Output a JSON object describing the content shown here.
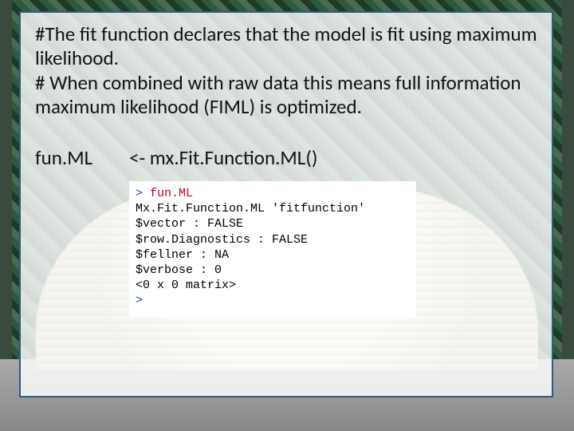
{
  "comment": {
    "line1": "#The fit function declares that the model is fit using maximum likelihood.",
    "line2": "# When combined with raw data this means full information maximum likelihood (FIML) is optimized."
  },
  "code": {
    "lhs": "fun.ML",
    "rhs": "<- mx.Fit.Function.ML()"
  },
  "console": {
    "prompt": ">",
    "input": "fun.ML",
    "lines": [
      "Mx.Fit.Function.ML 'fitfunction'",
      "$vector : FALSE",
      "$row.Diagnostics : FALSE",
      "$fellner : NA",
      "$verbose : 0",
      "<0 x 0 matrix>"
    ],
    "prompt2": ">"
  }
}
